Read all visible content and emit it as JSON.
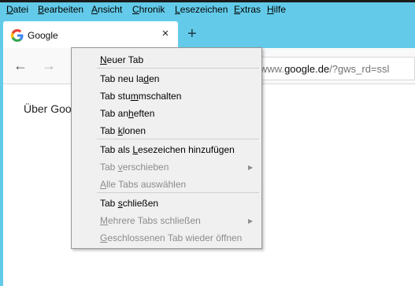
{
  "menubar": {
    "items": [
      {
        "pre": "",
        "acc": "D",
        "post": "atei"
      },
      {
        "pre": "",
        "acc": "B",
        "post": "earbeiten"
      },
      {
        "pre": "",
        "acc": "A",
        "post": "nsicht"
      },
      {
        "pre": "",
        "acc": "C",
        "post": "hronik"
      },
      {
        "pre": "",
        "acc": "L",
        "post": "esezeichen"
      },
      {
        "pre": "",
        "acc": "E",
        "post": "xtras"
      },
      {
        "pre": "",
        "acc": "H",
        "post": "ilfe"
      }
    ]
  },
  "tab": {
    "title": "Google",
    "close": "×",
    "favicon": "google-g-icon"
  },
  "newtab": "+",
  "nav": {
    "back": "←",
    "forward": "→"
  },
  "url": {
    "prefix": "www.",
    "host": "google.de",
    "path": "/?gws_rd=ssl"
  },
  "page": {
    "text": "Über Goo"
  },
  "context_menu": {
    "items": [
      {
        "pre": "",
        "acc": "N",
        "post": "euer Tab",
        "disabled": false
      },
      {
        "pre": "Tab neu la",
        "acc": "d",
        "post": "en",
        "disabled": false
      },
      {
        "pre": "Tab stu",
        "acc": "m",
        "post": "mschalten",
        "disabled": false
      },
      {
        "pre": "Tab an",
        "acc": "h",
        "post": "eften",
        "disabled": false
      },
      {
        "pre": "Tab ",
        "acc": "k",
        "post": "lonen",
        "disabled": false
      },
      {
        "pre": "Tab als ",
        "acc": "L",
        "post": "esezeichen hinzufügen",
        "disabled": false
      },
      {
        "pre": "Tab ",
        "acc": "v",
        "post": "erschieben",
        "disabled": true
      },
      {
        "pre": "",
        "acc": "A",
        "post": "lle Tabs auswählen",
        "disabled": true
      },
      {
        "pre": "Tab ",
        "acc": "s",
        "post": "chließen",
        "disabled": false
      },
      {
        "pre": "",
        "acc": "M",
        "post": "ehrere Tabs schließen",
        "disabled": true
      },
      {
        "pre": "",
        "acc": "G",
        "post": "eschlossenen Tab wieder öffnen",
        "disabled": true
      }
    ],
    "submenu_arrow": "▶"
  },
  "colors": {
    "titlebar": "#63cbe9",
    "google_blue": "#4285f4",
    "google_red": "#ea4335",
    "google_yellow": "#fbbc05",
    "google_green": "#34a853"
  }
}
